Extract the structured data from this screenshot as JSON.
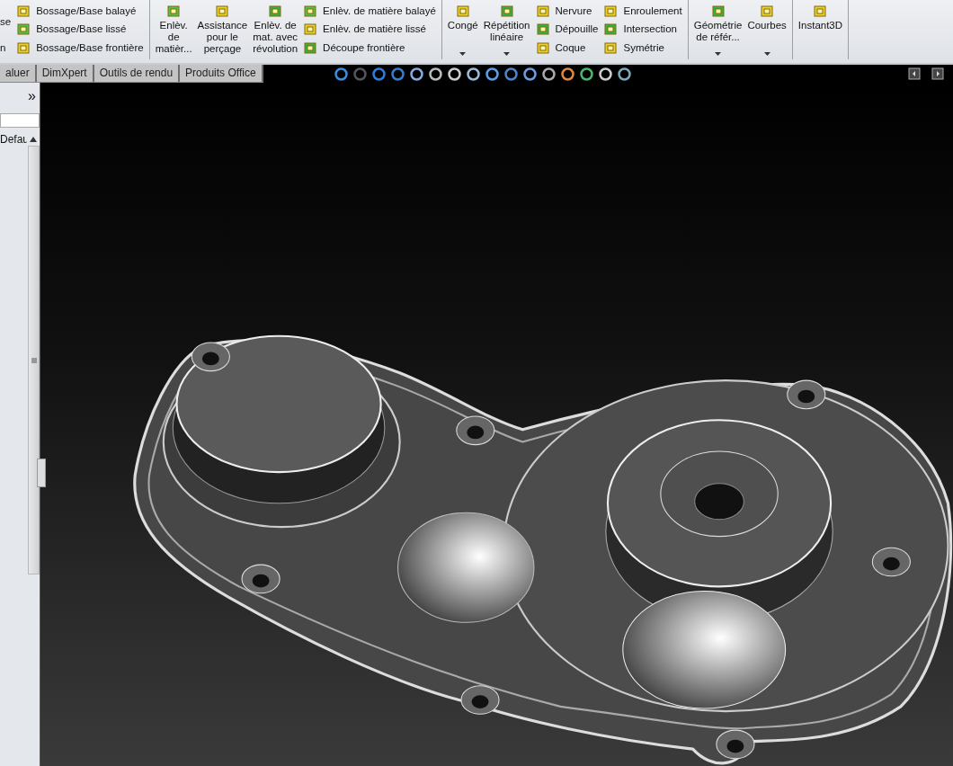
{
  "ribbon": {
    "groups": [
      {
        "columns": [
          {
            "kind": "cut",
            "items": [
              {
                "label": "se"
              },
              {
                "label": "n"
              }
            ]
          },
          {
            "kind": "stack",
            "items": [
              {
                "label": "Bossage/Base balayé"
              },
              {
                "label": "Bossage/Base lissé"
              },
              {
                "label": "Bossage/Base frontière"
              }
            ]
          }
        ]
      },
      {
        "columns": [
          {
            "kind": "large",
            "label": "Enlèv.\nde\nmatièr...",
            "dropdown": false
          },
          {
            "kind": "large",
            "label": "Assistance\npour le\nperçage",
            "dropdown": false
          },
          {
            "kind": "large",
            "label": "Enlèv. de\nmat. avec\nrévolution",
            "dropdown": false
          },
          {
            "kind": "stack",
            "items": [
              {
                "label": "Enlèv. de matière balayé"
              },
              {
                "label": "Enlèv. de matière lissé"
              },
              {
                "label": "Découpe frontière"
              }
            ]
          }
        ]
      },
      {
        "columns": [
          {
            "kind": "large",
            "label": "Congé",
            "dropdown": true
          },
          {
            "kind": "large",
            "label": "Répétition\nlinéaire",
            "dropdown": true
          },
          {
            "kind": "stack",
            "items": [
              {
                "label": "Nervure"
              },
              {
                "label": "Dépouille"
              },
              {
                "label": "Coque"
              }
            ]
          },
          {
            "kind": "stack",
            "items": [
              {
                "label": "Enroulement"
              },
              {
                "label": "Intersection"
              },
              {
                "label": "Symétrie"
              }
            ]
          }
        ]
      },
      {
        "columns": [
          {
            "kind": "large",
            "label": "Géométrie\nde référ...",
            "dropdown": true
          },
          {
            "kind": "large",
            "label": "Courbes",
            "dropdown": true
          }
        ]
      },
      {
        "columns": [
          {
            "kind": "large",
            "label": "Instant3D",
            "dropdown": false
          }
        ]
      }
    ]
  },
  "tabs": [
    {
      "label": "aluer",
      "selected": false
    },
    {
      "label": "DimXpert",
      "selected": false
    },
    {
      "label": "Outils de rendu",
      "selected": false
    },
    {
      "label": "Produits Office",
      "selected": false
    }
  ],
  "panel": {
    "expand": "»",
    "tree_item": "Defau"
  }
}
